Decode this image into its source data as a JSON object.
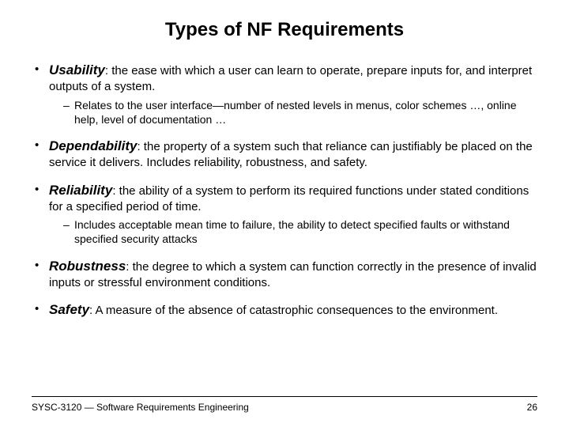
{
  "title": "Types of NF Requirements",
  "bullets": [
    {
      "term": "Usability",
      "def": ": the ease with which a user can learn to operate, prepare inputs for, and interpret outputs of a system.",
      "sub": [
        "Relates to the user interface—number of nested levels in menus, color schemes …, online help, level of documentation …"
      ]
    },
    {
      "term": "Dependability",
      "def": ": the property of a system such that reliance can justifiably be placed on the service it delivers. Includes reliability, robustness, and safety.",
      "sub": []
    },
    {
      "term": "Reliability",
      "def": ": the ability of a system to perform its required functions under stated conditions for a specified period of time.",
      "sub": [
        "Includes acceptable mean time to failure, the ability to detect specified faults or withstand specified security attacks"
      ]
    },
    {
      "term": "Robustness",
      "def": ": the degree to which a system can function correctly in the presence of invalid inputs or stressful environment conditions.",
      "sub": []
    },
    {
      "term": "Safety",
      "def": ": A measure of the absence of catastrophic consequences to the environment.",
      "sub": []
    }
  ],
  "footer": {
    "course": "SYSC-3120 — Software Requirements Engineering",
    "page": "26"
  }
}
